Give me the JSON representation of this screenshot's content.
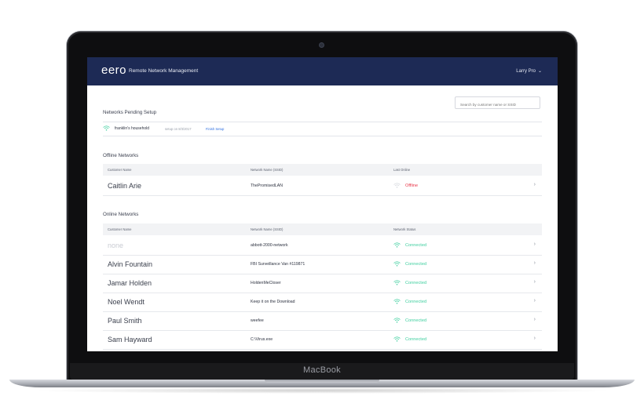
{
  "device": {
    "brand": "MacBook"
  },
  "header": {
    "logo": "eero",
    "title": "Remote Network Management",
    "user": "Larry Pro"
  },
  "search": {
    "placeholder": "Search by customer name or SSID"
  },
  "colors": {
    "header_bg": "#1d2a55",
    "connected": "#3fcf9f",
    "offline": "#e8374a",
    "link": "#2f6fe0"
  },
  "pending": {
    "title": "Networks Pending Setup",
    "items": [
      {
        "name": "franklin's household",
        "date": "setup on 8/3/2017",
        "action": "Finish Setup",
        "icon": "wifi-icon"
      }
    ]
  },
  "offline": {
    "title": "Offline Networks",
    "columns": [
      "Customer Name",
      "Network Name (SSID)",
      "Last Online"
    ],
    "rows": [
      {
        "customer": "Caitlin Arie",
        "ssid": "ThePromisedLAN",
        "status": "Offline"
      }
    ]
  },
  "online": {
    "title": "Online Networks",
    "columns": [
      "Customer Name",
      "Network Name (SSID)",
      "Network Status"
    ],
    "rows": [
      {
        "customer": "none",
        "ssid": "abbott-2000-network",
        "status": "Connected"
      },
      {
        "customer": "Alvin Fountain",
        "ssid": "FBI Surveillance Van #119871",
        "status": "Connected"
      },
      {
        "customer": "Jamar Holden",
        "ssid": "HoldenMeCloser",
        "status": "Connected"
      },
      {
        "customer": "Noel Wendt",
        "ssid": "Keep it on the Download",
        "status": "Connected"
      },
      {
        "customer": "Paul Smith",
        "ssid": "weefee",
        "status": "Connected"
      },
      {
        "customer": "Sam Hayward",
        "ssid": "C:\\Virus.exe",
        "status": "Connected"
      }
    ]
  }
}
